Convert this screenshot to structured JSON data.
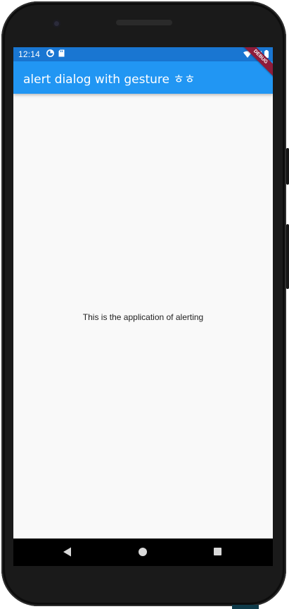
{
  "status_bar": {
    "time": "12:14",
    "color": "#1976d2"
  },
  "app_bar": {
    "title": "alert dialog with gesture ㅎㅎ",
    "color": "#2196f3"
  },
  "debug_banner": {
    "label": "DEBUG",
    "color": "#8e1b3a"
  },
  "body": {
    "message": "This is the application of alerting"
  },
  "nav_bar": {
    "icons": [
      "back-icon",
      "home-icon",
      "recents-icon"
    ]
  }
}
